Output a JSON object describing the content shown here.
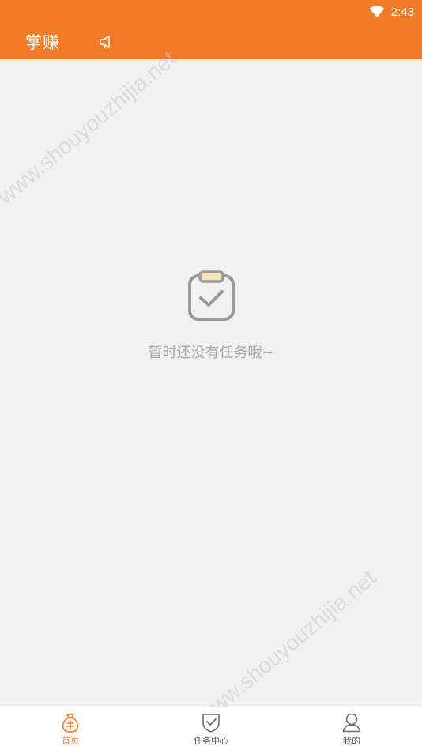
{
  "status_bar": {
    "time": "2:43",
    "icons": [
      "wifi-icon"
    ]
  },
  "header": {
    "title": "掌赚",
    "announcement_icon": "megaphone-icon"
  },
  "empty_state": {
    "icon": "clipboard-check-icon",
    "message": "暂时还没有任务哦~"
  },
  "watermark": {
    "text": "www.shouyouzhijia.net"
  },
  "bottom_nav": {
    "items": [
      {
        "label": "首页",
        "icon": "money-bag-icon",
        "active": true
      },
      {
        "label": "任务中心",
        "icon": "shield-check-icon",
        "active": false
      },
      {
        "label": "我的",
        "icon": "user-icon",
        "active": false
      }
    ]
  },
  "colors": {
    "accent": "#f27c26",
    "background": "#f1f1f1",
    "empty_text": "#a6a6a6"
  }
}
